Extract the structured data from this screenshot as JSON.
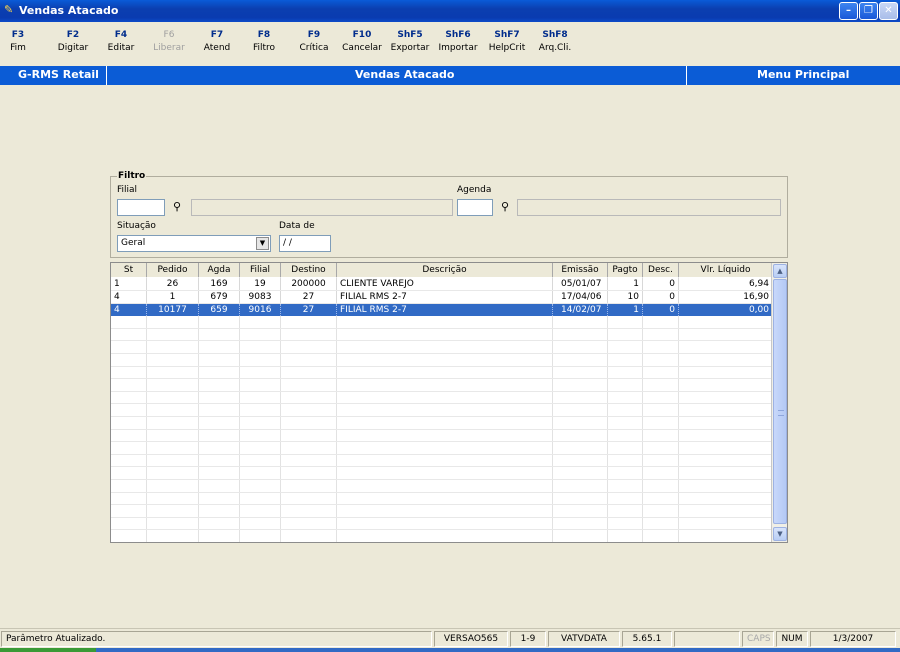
{
  "window": {
    "title": "Vendas Atacado",
    "icon": "app-icon"
  },
  "toolbar": {
    "items": [
      {
        "key": "F3",
        "label": "Fim",
        "enabled": true
      },
      {
        "key": "F2",
        "label": "Digitar",
        "enabled": true
      },
      {
        "key": "F4",
        "label": "Editar",
        "enabled": true
      },
      {
        "key": "F6",
        "label": "Liberar",
        "enabled": false
      },
      {
        "key": "F7",
        "label": "Atend",
        "enabled": true
      },
      {
        "key": "F8",
        "label": "Filtro",
        "enabled": true
      },
      {
        "key": "F9",
        "label": "Crítica",
        "enabled": true
      },
      {
        "key": "F10",
        "label": "Cancelar",
        "enabled": true
      },
      {
        "key": "ShF5",
        "label": "Exportar",
        "enabled": true
      },
      {
        "key": "ShF6",
        "label": "Importar",
        "enabled": true
      },
      {
        "key": "ShF7",
        "label": "HelpCrit",
        "enabled": true
      },
      {
        "key": "ShF8",
        "label": "Arq.Cli.",
        "enabled": true
      }
    ]
  },
  "header": {
    "left": "G-RMS Retail",
    "center": "Vendas Atacado",
    "right": "Menu Principal"
  },
  "filter": {
    "legend": "Filtro",
    "filial_label": "Filial",
    "filial_value": "",
    "filial_desc": "",
    "agenda_label": "Agenda",
    "agenda_value": "",
    "agenda_desc": "",
    "situacao_label": "Situação",
    "situacao_value": "Geral",
    "data_label": "Data de",
    "data_value": " / /"
  },
  "grid": {
    "columns": [
      "St",
      "Pedido",
      "Agda",
      "Filial",
      "Destino",
      "Descrição",
      "Emissão",
      "Pagto",
      "Desc.",
      "Vlr. Líquido"
    ],
    "rows": [
      {
        "st": "1",
        "pedido": "26",
        "agda": "169",
        "filial": "19",
        "destino": "200000",
        "descricao": "CLIENTE VAREJO",
        "emissao": "05/01/07",
        "pagto": "1",
        "desc": "0",
        "vlr": "6,94"
      },
      {
        "st": "4",
        "pedido": "1",
        "agda": "679",
        "filial": "9083",
        "destino": "27",
        "descricao": "FILIAL RMS 2-7",
        "emissao": "17/04/06",
        "pagto": "10",
        "desc": "0",
        "vlr": "16,90"
      },
      {
        "st": "4",
        "pedido": "10177",
        "agda": "659",
        "filial": "9016",
        "destino": "27",
        "descricao": "FILIAL RMS 2-7",
        "emissao": "14/02/07",
        "pagto": "1",
        "desc": "0",
        "vlr": "0,00"
      }
    ],
    "selected_row": 2
  },
  "status": {
    "message": "Parâmetro Atualizado.",
    "version": "VERSAO565",
    "p2": "1-9",
    "p3": "VATVDATA",
    "p4": "5.65.1",
    "p5": "",
    "caps": "CAPS",
    "num": "NUM",
    "date": "1/3/2007"
  }
}
